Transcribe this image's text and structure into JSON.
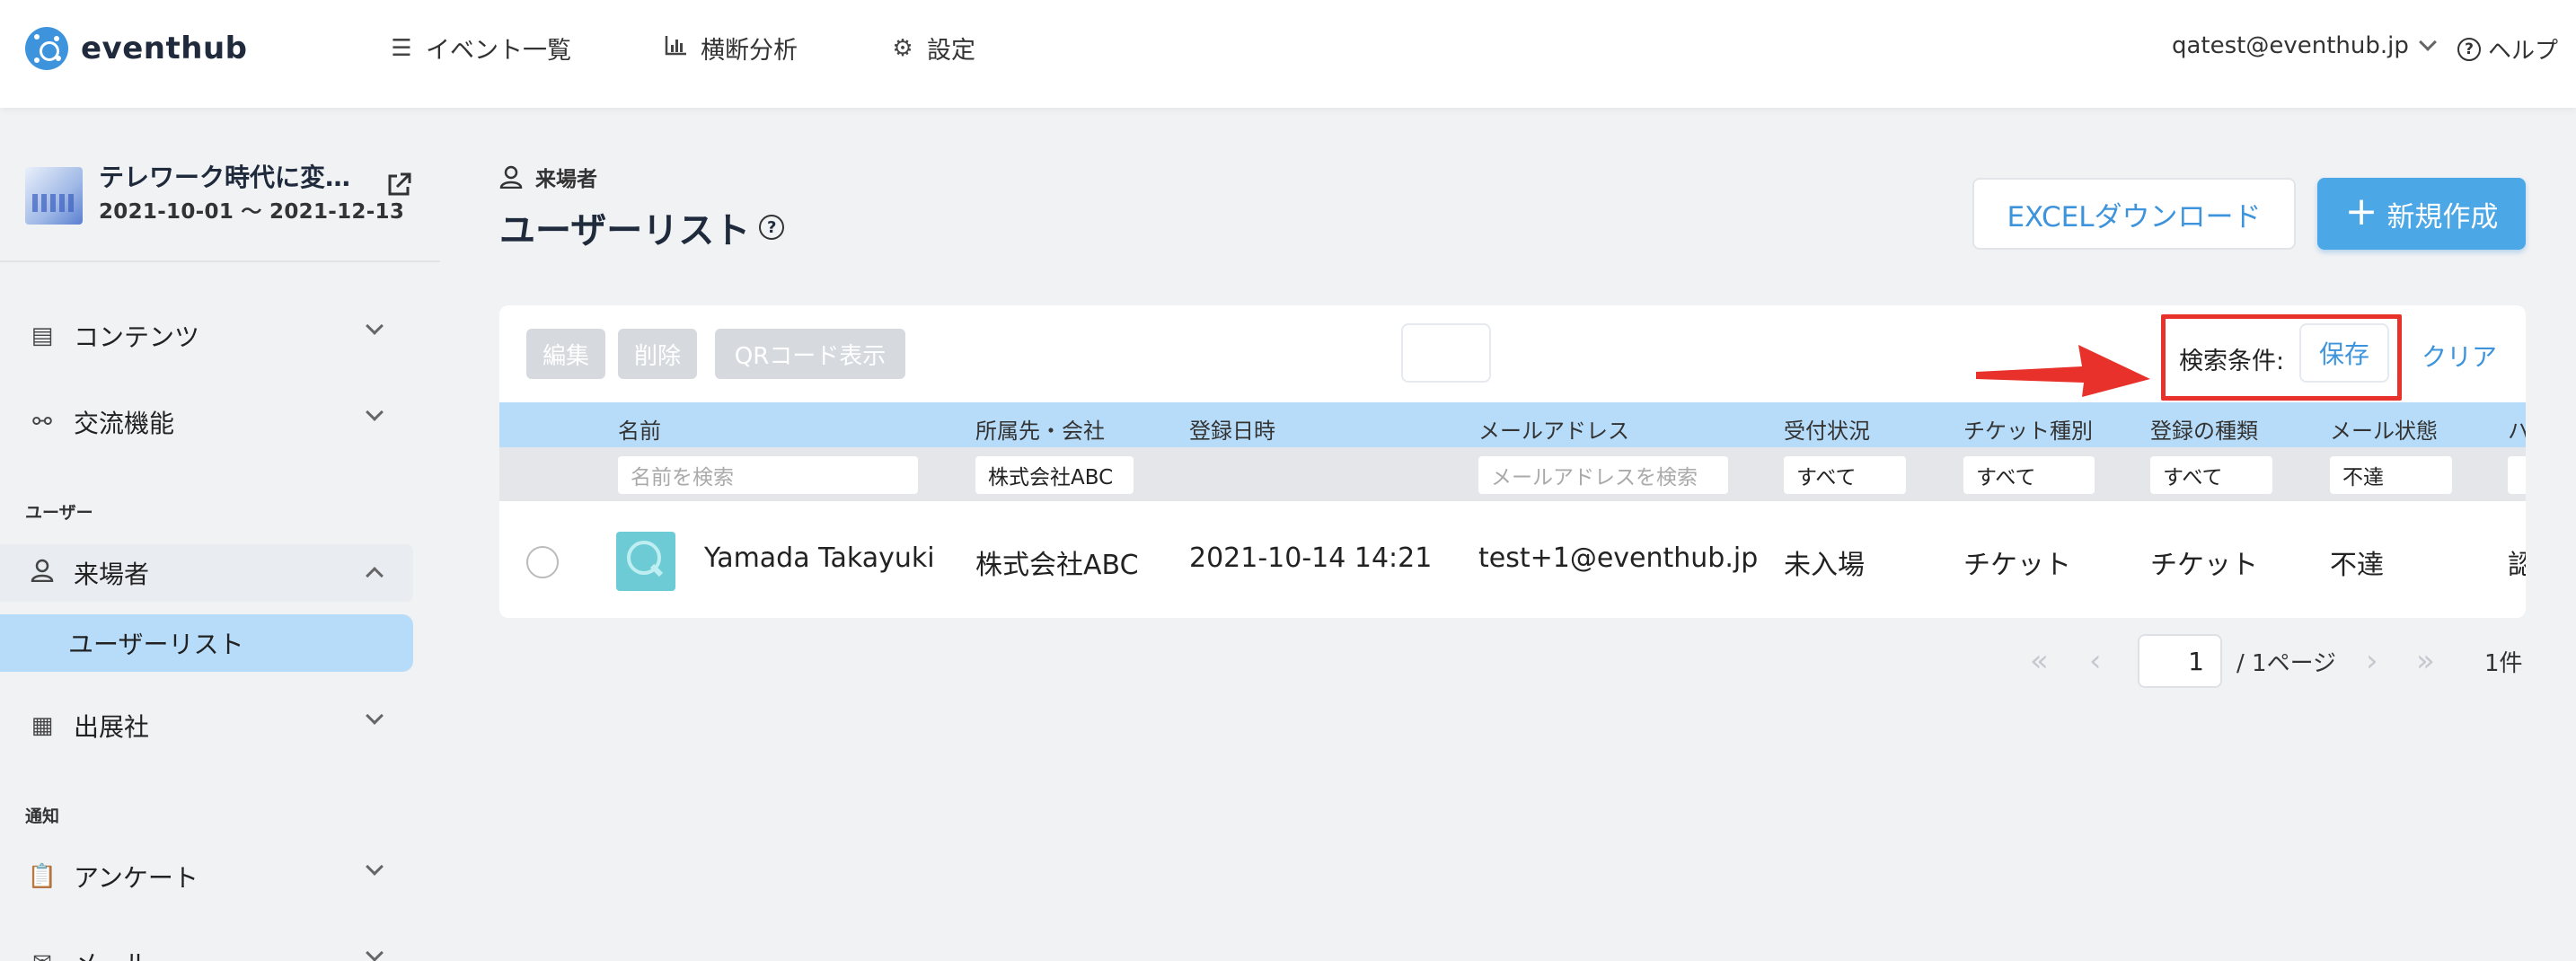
{
  "app": {
    "brand": "eventhub"
  },
  "nav": {
    "items": [
      {
        "label": "イベント一覧",
        "icon": "list-icon"
      },
      {
        "label": "横断分析",
        "icon": "bar-chart-icon"
      },
      {
        "label": "設定",
        "icon": "gear-icon"
      }
    ],
    "user_email": "qatest@eventhub.jp",
    "help_label": "ヘルプ"
  },
  "event": {
    "title": "テレワーク時代に変…",
    "dates": "2021-10-01 ～ 2021-12-13"
  },
  "sidebar": {
    "contents": "コンテンツ",
    "exchange": "交流機能",
    "section_user": "ユーザー",
    "visitors": "来場者",
    "user_list": "ユーザーリスト",
    "exhibitors": "出展社",
    "section_notify": "通知",
    "survey": "アンケート",
    "mail": "メール"
  },
  "page": {
    "breadcrumb": "来場者",
    "title": "ユーザーリスト",
    "excel_button": "EXCELダウンロード",
    "new_button": "新規作成"
  },
  "toolbar": {
    "edit": "編集",
    "delete": "削除",
    "qr": "QRコード表示",
    "search_condition": "検索条件:",
    "save": "保存",
    "clear": "クリア"
  },
  "table": {
    "columns": [
      "名前",
      "所属先・会社",
      "登録日時",
      "メールアドレス",
      "受付状況",
      "チケット種別",
      "登録の種類",
      "メール状態",
      "ハ"
    ],
    "filters": {
      "name_placeholder": "名前を検索",
      "company_value": "株式会社ABC",
      "email_placeholder": "メールアドレスを検索",
      "reception": "すべて",
      "ticket": "すべて",
      "reg_type": "すべて",
      "mail_status": "不達"
    },
    "rows": [
      {
        "name": "Yamada Takayuki",
        "company": "株式会社ABC",
        "registered": "2021-10-14 14:21",
        "email": "test+1@eventhub.jp",
        "reception": "未入場",
        "ticket": "チケット",
        "reg_type": "チケット",
        "mail_status": "不達",
        "extra": "認"
      }
    ]
  },
  "pagination": {
    "current": "1",
    "total_label": "/ 1ページ",
    "count": "1件"
  },
  "colors": {
    "accent": "#3d94dc",
    "header_row": "#b7dcf9",
    "highlight": "#e8312a"
  }
}
